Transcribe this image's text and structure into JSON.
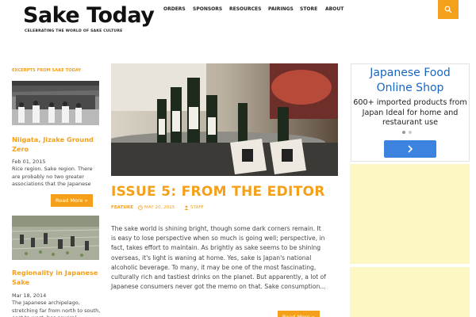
{
  "header": {
    "logo_title": "Sake Today",
    "tagline": "CELEBRATING THE WORLD OF SAKE CULTURE",
    "nav": [
      "ORDERS",
      "SPONSORS",
      "RESOURCES",
      "PAIRINGS",
      "STORE",
      "ABOUT"
    ],
    "search_icon": "search-icon"
  },
  "sidebar": {
    "heading": "EXCERPTS FROM SAKE TODAY",
    "posts": [
      {
        "title": "Niigata, Jizake Ground Zero",
        "date": "Feb 01, 2015",
        "excerpt": "Rice region. Sake region. There are probably no two greater associations that the Japanese",
        "read_more": "Read More »"
      },
      {
        "title": "Regionality in Japanese Sake",
        "date": "Mar 18, 2014",
        "excerpt": "The Japanese archipelago, stretching far from north to south, east to west, has several"
      }
    ]
  },
  "main": {
    "title": "ISSUE 5: FROM THE EDITOR",
    "category": "FEATURE",
    "date": "MAY 20, 2015",
    "author": "STAFF",
    "body": "The sake world is shining bright, though some dark corners remain. It is easy to lose perspective when so much is going well; perspective, in fact, takes effort to maintain. As brightly as sake seems to be shining overseas, it's light is waning at home. Yes, sake is Japan's national alcoholic beverage. To many, it may be one of the most fascinating, culturally rich and tastiest drinks on the planet. But apparently, a lot of Japanese consumers never got the memo on that. Sake consumption…",
    "read_more": "Read More »"
  },
  "ad": {
    "title": "Japanese Food Online Shop",
    "body": "600+ imported products from Japan Ideal for home and restaurant use",
    "button_icon": "chevron-right-icon"
  },
  "colors": {
    "accent": "#f5a01a",
    "ad_blue": "#1a66c4",
    "ad_button": "#3c83e0",
    "yellow_panel": "#fdf7c3"
  }
}
